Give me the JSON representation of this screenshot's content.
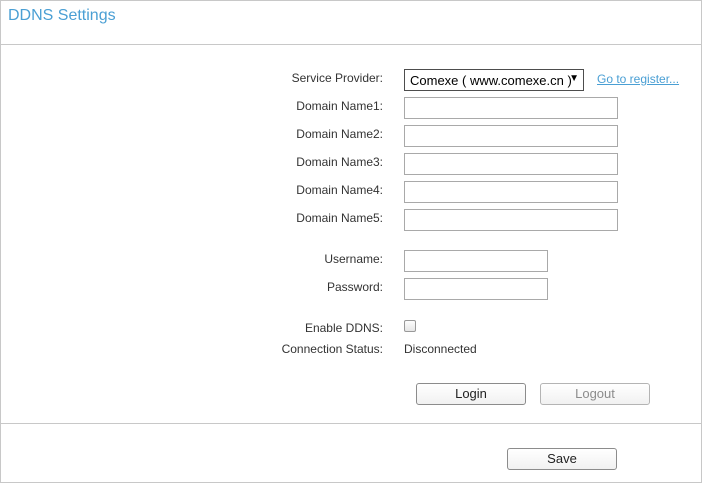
{
  "title": "DDNS Settings",
  "form": {
    "service_provider": {
      "label": "Service Provider:",
      "selected": "Comexe ( www.comexe.cn )",
      "register_link": "Go to register..."
    },
    "domains": [
      {
        "label": "Domain Name1:",
        "value": ""
      },
      {
        "label": "Domain Name2:",
        "value": ""
      },
      {
        "label": "Domain Name3:",
        "value": ""
      },
      {
        "label": "Domain Name4:",
        "value": ""
      },
      {
        "label": "Domain Name5:",
        "value": ""
      }
    ],
    "username": {
      "label": "Username:",
      "value": ""
    },
    "password": {
      "label": "Password:",
      "value": ""
    },
    "enable_ddns": {
      "label": "Enable DDNS:",
      "checked": false
    },
    "connection_status": {
      "label": "Connection Status:",
      "value": "Disconnected"
    }
  },
  "buttons": {
    "login": "Login",
    "logout": "Logout",
    "save": "Save"
  },
  "icons": {
    "select_arrow": "chevron-down-icon"
  }
}
